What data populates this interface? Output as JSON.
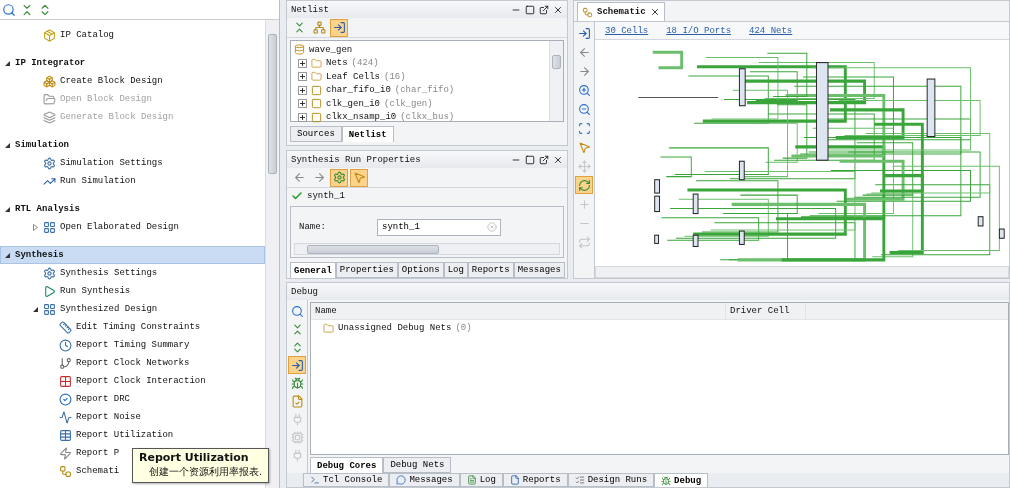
{
  "flow_navigator": {
    "toolbar": [
      {
        "kind": "search"
      },
      {
        "kind": "collapse"
      },
      {
        "kind": "expand"
      }
    ],
    "sections": [
      {
        "items": [
          {
            "label": "IP Catalog",
            "kind": "catalog",
            "disabled": false
          }
        ]
      },
      {
        "title": "IP Integrator",
        "expanded": true,
        "selected": false,
        "items": [
          {
            "label": "Create Block Design",
            "kind": "blocks",
            "disabled": false
          },
          {
            "label": "Open Block Design",
            "kind": "open",
            "disabled": true
          },
          {
            "label": "Generate Block Design",
            "kind": "generate",
            "disabled": true
          }
        ]
      },
      {
        "title": "Simulation",
        "expanded": true,
        "selected": false,
        "items": [
          {
            "label": "Simulation Settings",
            "kind": "gear",
            "disabled": false
          },
          {
            "label": "Run Simulation",
            "kind": "chart",
            "disabled": false
          }
        ]
      },
      {
        "title": "RTL Analysis",
        "expanded": true,
        "selected": false,
        "items": [
          {
            "label": "Open Elaborated Design",
            "kind": "design",
            "disabled": false,
            "expanded": false
          }
        ]
      },
      {
        "title": "Synthesis",
        "expanded": true,
        "selected": true,
        "items": [
          {
            "label": "Synthesis Settings",
            "kind": "gear",
            "disabled": false
          },
          {
            "label": "Run Synthesis",
            "kind": "run",
            "disabled": false
          },
          {
            "label": "Synthesized Design",
            "kind": "design",
            "disabled": false,
            "expanded": true,
            "children": [
              {
                "label": "Edit Timing Constraints",
                "kind": "timing",
                "disabled": false
              },
              {
                "label": "Report Timing Summary",
                "kind": "clock",
                "disabled": false
              },
              {
                "label": "Report Clock Networks",
                "kind": "network",
                "disabled": false
              },
              {
                "label": "Report Clock Interaction",
                "kind": "grid",
                "disabled": false
              },
              {
                "label": "Report DRC",
                "kind": "check",
                "disabled": false
              },
              {
                "label": "Report Noise",
                "kind": "noise",
                "disabled": false
              },
              {
                "label": "Report Utilization",
                "kind": "table",
                "disabled": false
              },
              {
                "label": "Report P",
                "kind": "power",
                "disabled": false
              },
              {
                "label": "Schemati",
                "kind": "schematic",
                "disabled": false
              }
            ]
          }
        ]
      }
    ],
    "tooltip": {
      "title": "Report Utilization",
      "text": "创建一个资源利用率报表."
    }
  },
  "netlist": {
    "title": "Netlist",
    "toolbar": [
      {
        "kind": "collapse",
        "selected": false
      },
      {
        "kind": "hierarchy",
        "selected": false
      },
      {
        "kind": "import",
        "selected": true
      }
    ],
    "tree": {
      "label": "wave_gen",
      "children": [
        {
          "label": "Nets",
          "detail": "(424)",
          "kind": "folder"
        },
        {
          "label": "Leaf Cells",
          "detail": "(16)",
          "kind": "folder"
        },
        {
          "label": "char_fifo_i0",
          "detail": "(char_fifo)",
          "kind": "cell"
        },
        {
          "label": "clk_gen_i0",
          "detail": "(clk_gen)",
          "kind": "cell"
        },
        {
          "label": "clkx_nsamp_i0",
          "detail": "(clkx_bus)",
          "kind": "cell"
        }
      ]
    },
    "tabs": [
      {
        "label": "Sources",
        "selected": false
      },
      {
        "label": "Netlist",
        "selected": true
      }
    ]
  },
  "properties": {
    "title": "Synthesis Run Properties",
    "toolbar": [
      {
        "kind": "back",
        "selected": false
      },
      {
        "kind": "forward",
        "selected": false
      },
      {
        "kind": "settings",
        "selected": true
      },
      {
        "kind": "pointer",
        "selected": true
      }
    ],
    "run": "synth_1",
    "fields": [
      {
        "label": "Name:",
        "value": "synth_1"
      }
    ],
    "tabs": [
      {
        "label": "General",
        "selected": true
      },
      {
        "label": "Properties",
        "selected": false
      },
      {
        "label": "Options",
        "selected": false
      },
      {
        "label": "Log",
        "selected": false
      },
      {
        "label": "Reports",
        "selected": false
      },
      {
        "label": "Messages",
        "selected": false
      }
    ]
  },
  "schematic": {
    "tab": "Schematic",
    "links": [
      "30 Cells",
      "18 I/O Ports",
      "424 Nets"
    ],
    "toolbar": [
      {
        "kind": "import",
        "selected": false,
        "disabled": false
      },
      {
        "kind": "back",
        "selected": false,
        "disabled": false
      },
      {
        "kind": "forward",
        "selected": false,
        "disabled": false
      },
      {
        "kind": "zoomin",
        "selected": false,
        "disabled": false
      },
      {
        "kind": "zoomout",
        "selected": false,
        "disabled": false
      },
      {
        "kind": "zoomfit",
        "selected": false,
        "disabled": false
      },
      {
        "kind": "pointer",
        "selected": false,
        "disabled": false
      },
      {
        "kind": "move",
        "selected": false,
        "disabled": true
      },
      {
        "kind": "autofit",
        "selected": true,
        "disabled": false
      },
      {
        "kind": "plus",
        "selected": false,
        "disabled": true
      },
      {
        "kind": "minus",
        "selected": false,
        "disabled": true
      },
      {
        "kind": "swap",
        "selected": false,
        "disabled": true
      }
    ]
  },
  "debug": {
    "title": "Debug",
    "toolbar": [
      {
        "kind": "search",
        "selected": false,
        "disabled": false
      },
      {
        "kind": "collapse",
        "selected": false,
        "disabled": false
      },
      {
        "kind": "expand",
        "selected": false,
        "disabled": false
      },
      {
        "kind": "import",
        "selected": true,
        "disabled": false
      },
      {
        "kind": "bug",
        "selected": false,
        "disabled": false
      },
      {
        "kind": "note",
        "selected": false,
        "disabled": false
      },
      {
        "kind": "plug",
        "selected": false,
        "disabled": true
      },
      {
        "kind": "chip",
        "selected": false,
        "disabled": true
      },
      {
        "kind": "plug",
        "selected": false,
        "disabled": true
      }
    ],
    "columns": [
      "Name",
      "Driver Cell"
    ],
    "rows": [
      {
        "label": "Unassigned Debug Nets",
        "detail": "(0)"
      }
    ],
    "tabs": [
      {
        "label": "Debug Cores",
        "selected": true
      },
      {
        "label": "Debug Nets",
        "selected": false
      }
    ]
  },
  "bottom_tabs": [
    {
      "label": "Tcl Console",
      "kind": "console",
      "selected": false
    },
    {
      "label": "Messages",
      "kind": "messages",
      "selected": false
    },
    {
      "label": "Log",
      "kind": "log",
      "selected": false
    },
    {
      "label": "Reports",
      "kind": "reports",
      "selected": false
    },
    {
      "label": "Design Runs",
      "kind": "runs",
      "selected": false
    },
    {
      "label": "Debug",
      "kind": "bug",
      "selected": true
    }
  ]
}
